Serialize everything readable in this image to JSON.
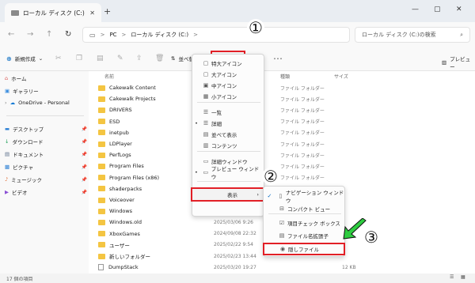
{
  "window": {
    "tab_title": "ローカル ディスク (C:)",
    "newtab": "+"
  },
  "address": {
    "pc": "PC",
    "sep": ">",
    "drive": "ローカル ディスク (C:)",
    "search_placeholder": "ローカル ディスク (C:)の検索"
  },
  "commandbar": {
    "new": "新規作成",
    "sort": "並べ替え",
    "view": "表示",
    "more": "･･･",
    "preview": "プレビュー"
  },
  "sidebar": {
    "home": "ホーム",
    "gallery": "ギャラリー",
    "onedrive": "OneDrive - Personal",
    "desktop": "デスクトップ",
    "downloads": "ダウンロード",
    "documents": "ドキュメント",
    "pictures": "ピクチャ",
    "music": "ミュージック",
    "videos": "ビデオ"
  },
  "columns": {
    "name": "名前",
    "type": "種類",
    "size": "サイズ"
  },
  "files": [
    {
      "name": "Cakewalk Content",
      "date": "",
      "type": "ファイル フォルダー",
      "size": "",
      "kind": "folder"
    },
    {
      "name": "Cakewalk Projects",
      "date": "",
      "type": "ファイル フォルダー",
      "size": "",
      "kind": "folder"
    },
    {
      "name": "DRIVERS",
      "date": "",
      "type": "ファイル フォルダー",
      "size": "",
      "kind": "folder"
    },
    {
      "name": "ESD",
      "date": "",
      "type": "ファイル フォルダー",
      "size": "",
      "kind": "folder"
    },
    {
      "name": "inetpub",
      "date": "",
      "type": "ファイル フォルダー",
      "size": "",
      "kind": "folder"
    },
    {
      "name": "LDPlayer",
      "date": "",
      "type": "ファイル フォルダー",
      "size": "",
      "kind": "folder"
    },
    {
      "name": "PerfLogs",
      "date": "",
      "type": "ファイル フォルダー",
      "size": "",
      "kind": "folder"
    },
    {
      "name": "Program Files",
      "date": "",
      "type": "ファイル フォルダー",
      "size": "",
      "kind": "folder"
    },
    {
      "name": "Program Files (x86)",
      "date": "",
      "type": "ファイル フォルダー",
      "size": "",
      "kind": "folder"
    },
    {
      "name": "shaderpacks",
      "date": "",
      "type": "ファイル フォルダー",
      "size": "",
      "kind": "folder"
    },
    {
      "name": "Voiceover",
      "date": "",
      "type": "ファイル フォルダー",
      "size": "",
      "kind": "folder"
    },
    {
      "name": "Windows",
      "date": "",
      "type": "",
      "size": "",
      "kind": "folder"
    },
    {
      "name": "Windows.old",
      "date": "2025/03/06 9:26",
      "type": "",
      "size": "",
      "kind": "folder"
    },
    {
      "name": "XboxGames",
      "date": "2024/09/08 22:32",
      "type": "",
      "size": "",
      "kind": "folder"
    },
    {
      "name": "ユーザー",
      "date": "2025/02/22 9:54",
      "type": "",
      "size": "",
      "kind": "folder"
    },
    {
      "name": "新しいフォルダー",
      "date": "2025/02/23 13:44",
      "type": "",
      "size": "",
      "kind": "folder"
    },
    {
      "name": "DumpStack",
      "date": "2025/03/20 19:27",
      "type": "",
      "size": "12 KB",
      "kind": "file"
    }
  ],
  "view_menu": [
    {
      "label": "特大アイコン",
      "icon": "▢",
      "dot": ""
    },
    {
      "label": "大アイコン",
      "icon": "▢",
      "dot": ""
    },
    {
      "label": "中アイコン",
      "icon": "▣",
      "dot": ""
    },
    {
      "label": "小アイコン",
      "icon": "▦",
      "dot": ""
    },
    {
      "label": "一覧",
      "icon": "☰",
      "dot": ""
    },
    {
      "label": "詳細",
      "icon": "☰",
      "dot": "•"
    },
    {
      "label": "並べて表示",
      "icon": "▤",
      "dot": ""
    },
    {
      "label": "コンテンツ",
      "icon": "▥",
      "dot": ""
    },
    {
      "label": "詳細ウィンドウ",
      "icon": "▭",
      "dot": ""
    },
    {
      "label": "プレビュー ウィンドウ",
      "icon": "▭",
      "dot": "•"
    },
    {
      "label": "表示",
      "icon": "",
      "dot": "",
      "arrow": "›"
    }
  ],
  "show_submenu": [
    {
      "label": "ナビゲーション ウィンドウ",
      "check": "✓",
      "icon": "▯"
    },
    {
      "label": "コンパクト ビュー",
      "check": "",
      "icon": "⊟"
    },
    {
      "label": "項目チェック ボックス",
      "check": "",
      "icon": "☑"
    },
    {
      "label": "ファイル名拡張子",
      "check": "",
      "icon": "▤"
    },
    {
      "label": "隠しファイル",
      "check": "",
      "icon": "◉"
    }
  ],
  "callouts": {
    "one": "①",
    "two": "②",
    "three": "③"
  },
  "status": "17 個の項目",
  "colors": {
    "highlight": "#e21f26",
    "arrow": "#2ecc40",
    "folder": "#f4c542",
    "accent": "#0067c0"
  }
}
